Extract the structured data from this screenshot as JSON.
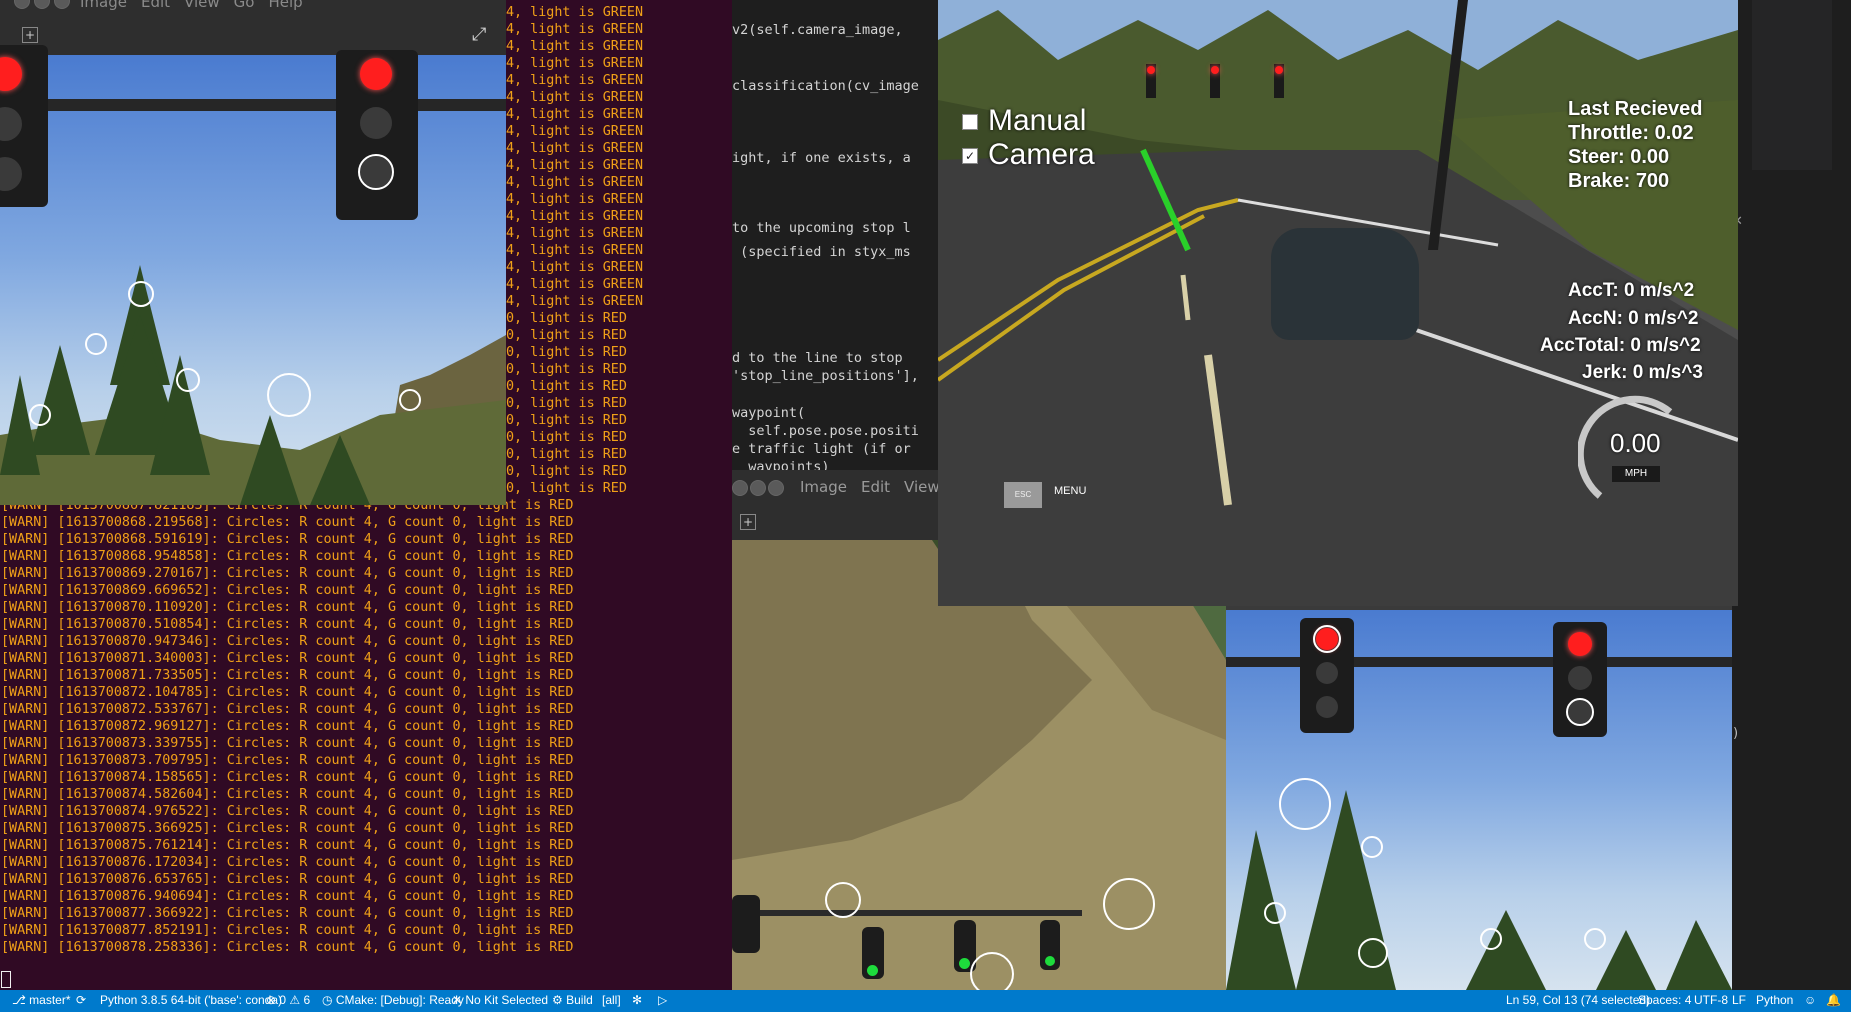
{
  "terminal": {
    "green_lines": [
      "4, light is GREEN",
      "4, light is GREEN",
      "4, light is GREEN",
      "4, light is GREEN",
      "4, light is GREEN",
      "4, light is GREEN",
      "4, light is GREEN",
      "4, light is GREEN",
      "4, light is GREEN",
      "4, light is GREEN",
      "4, light is GREEN",
      "4, light is GREEN",
      "4, light is GREEN",
      "4, light is GREEN",
      "4, light is GREEN",
      "4, light is GREEN",
      "4, light is GREEN",
      "4, light is GREEN"
    ],
    "red_tail_lines": [
      "0, light is RED",
      "0, light is RED",
      "0, light is RED",
      "0, light is RED",
      "0, light is RED",
      "0, light is RED",
      "0, light is RED",
      "0, light is RED",
      "0, light is RED",
      "0, light is RED",
      "0, light is RED"
    ],
    "full_lines": [
      "[WARN] [1613700867.821183]: Circles: R count 4, G count 0, light is RED",
      "[WARN] [1613700868.219568]: Circles: R count 4, G count 0, light is RED",
      "[WARN] [1613700868.591619]: Circles: R count 4, G count 0, light is RED",
      "[WARN] [1613700868.954858]: Circles: R count 4, G count 0, light is RED",
      "[WARN] [1613700869.270167]: Circles: R count 4, G count 0, light is RED",
      "[WARN] [1613700869.669652]: Circles: R count 4, G count 0, light is RED",
      "[WARN] [1613700870.110920]: Circles: R count 4, G count 0, light is RED",
      "[WARN] [1613700870.510854]: Circles: R count 4, G count 0, light is RED",
      "[WARN] [1613700870.947346]: Circles: R count 4, G count 0, light is RED",
      "[WARN] [1613700871.340003]: Circles: R count 4, G count 0, light is RED",
      "[WARN] [1613700871.733505]: Circles: R count 4, G count 0, light is RED",
      "[WARN] [1613700872.104785]: Circles: R count 4, G count 0, light is RED",
      "[WARN] [1613700872.533767]: Circles: R count 4, G count 0, light is RED",
      "[WARN] [1613700872.969127]: Circles: R count 4, G count 0, light is RED",
      "[WARN] [1613700873.339755]: Circles: R count 4, G count 0, light is RED",
      "[WARN] [1613700873.709795]: Circles: R count 4, G count 0, light is RED",
      "[WARN] [1613700874.158565]: Circles: R count 4, G count 0, light is RED",
      "[WARN] [1613700874.582604]: Circles: R count 4, G count 0, light is RED",
      "[WARN] [1613700874.976522]: Circles: R count 4, G count 0, light is RED",
      "[WARN] [1613700875.366925]: Circles: R count 4, G count 0, light is RED",
      "[WARN] [1613700875.761214]: Circles: R count 4, G count 0, light is RED",
      "[WARN] [1613700876.172034]: Circles: R count 4, G count 0, light is RED",
      "[WARN] [1613700876.653765]: Circles: R count 4, G count 0, light is RED",
      "[WARN] [1613700876.940694]: Circles: R count 4, G count 0, light is RED",
      "[WARN] [1613700877.366922]: Circles: R count 4, G count 0, light is RED",
      "[WARN] [1613700877.852191]: Circles: R count 4, G count 0, light is RED",
      "[WARN] [1613700878.258336]: Circles: R count 4, G count 0, light is RED"
    ]
  },
  "viewer_top": {
    "menu": [
      "Image",
      "Edit",
      "View",
      "Go",
      "Help"
    ]
  },
  "viewer_bottom": {
    "menu": [
      "Image",
      "Edit",
      "View"
    ]
  },
  "editor": {
    "lines": [
      "v2(self.camera_image,",
      "classification(cv_image",
      "ight, if one exists, a",
      "to the upcoming stop l",
      " (specified in styx_ms",
      "d to the line to stop",
      "'stop_line_positions'],",
      "waypoint(",
      "  self.pose.pose.positi",
      "e traffic light (if or",
      "  waypoints)"
    ]
  },
  "simulator": {
    "manual_label": "Manual",
    "camera_label": "Camera",
    "manual_checked": false,
    "camera_checked": true,
    "last_received": "Last Recieved",
    "throttle": "Throttle: 0.02",
    "steer": "Steer: 0.00",
    "brake": "Brake: 700",
    "acct": "AccT: 0 m/s^2",
    "accn": "AccN: 0 m/s^2",
    "acctotal": "AccTotal: 0 m/s^2",
    "jerk": "Jerk: 0 m/s^3",
    "speed": "0.00",
    "speed_unit": "MPH",
    "esc_label": "ESC",
    "menu_label": "MENU"
  },
  "statusbar": {
    "branch": "master*",
    "python": "Python 3.8.5 64-bit ('base': conda)",
    "problems": "0 ⚠ 6",
    "cmake": "CMake: [Debug]: Ready",
    "kit": "No Kit Selected",
    "build": "Build",
    "target": "[all]",
    "position": "Ln 59, Col 13 (74 selected)",
    "spaces": "Spaces: 4",
    "encoding": "UTF-8",
    "eol": "LF",
    "language": "Python"
  }
}
